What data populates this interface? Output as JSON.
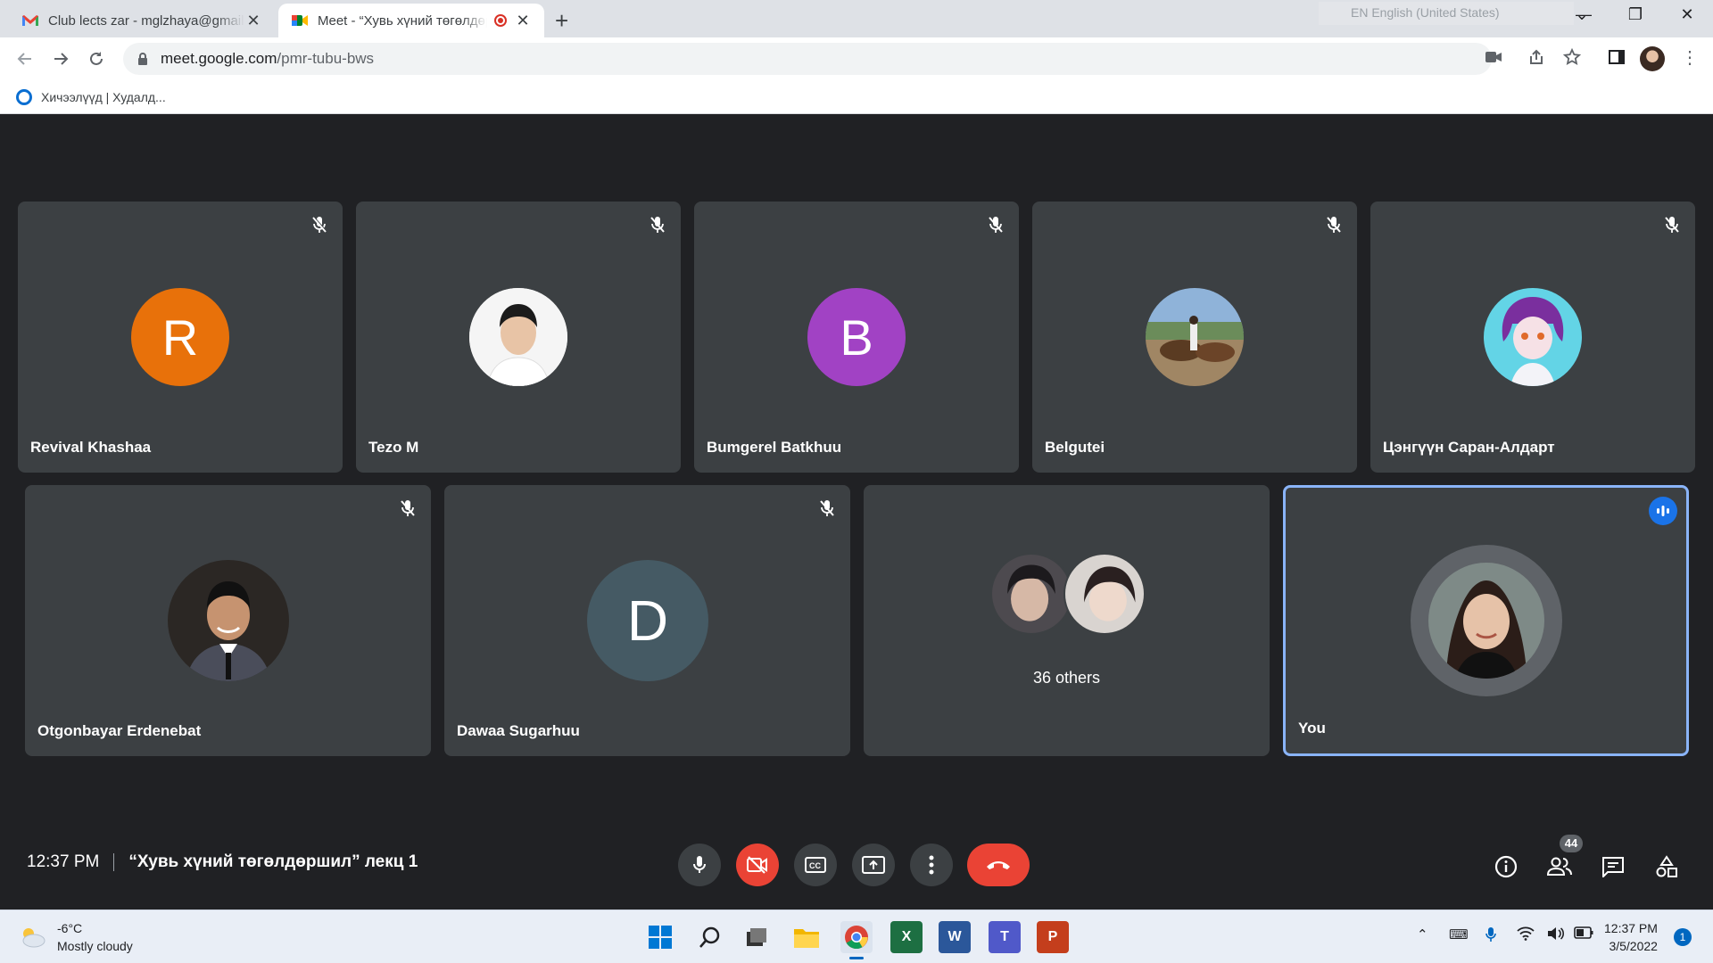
{
  "browser": {
    "tabs": [
      {
        "title": "Club lects zar - mglzhaya@gmail.com",
        "icon": "gmail-icon"
      },
      {
        "title": "Meet - “Хувь хүний төгөлдөршил”",
        "icon": "meet-icon",
        "recording": true
      }
    ],
    "language_indicator": "EN English (United States)",
    "url_host": "meet.google.com",
    "url_path": "/pmr-tubu-bws",
    "bookmark": "Хичээлүүд | Худалд..."
  },
  "meet": {
    "participants": [
      {
        "name": "Revival Khashaa",
        "initial": "R",
        "color": "#e8710a",
        "muted": true
      },
      {
        "name": "Tezo M",
        "initial": "",
        "photo": true,
        "muted": true
      },
      {
        "name": "Bumgerel Batkhuu",
        "initial": "B",
        "color": "#a142c4",
        "muted": true
      },
      {
        "name": "Belgutei",
        "initial": "",
        "photo": true,
        "muted": true
      },
      {
        "name": "Цэнгүүн Саран-Алдарт",
        "initial": "",
        "photo": true,
        "muted": true
      },
      {
        "name": "Otgonbayar Erdenebat",
        "initial": "",
        "photo": true,
        "muted": true
      },
      {
        "name": "Dawaa Sugarhuu",
        "initial": "D",
        "color": "#455a64",
        "muted": true
      },
      {
        "others_label": "36 others"
      },
      {
        "name": "You",
        "speaking": true
      }
    ],
    "time": "12:37 PM",
    "meeting_title": "“Хувь хүний төгөлдөршил” лекц 1",
    "people_count": "44"
  },
  "taskbar": {
    "weather_temp": "-6°C",
    "weather_desc": "Mostly cloudy",
    "time": "12:37 PM",
    "date": "3/5/2022",
    "notification_count": "1"
  }
}
